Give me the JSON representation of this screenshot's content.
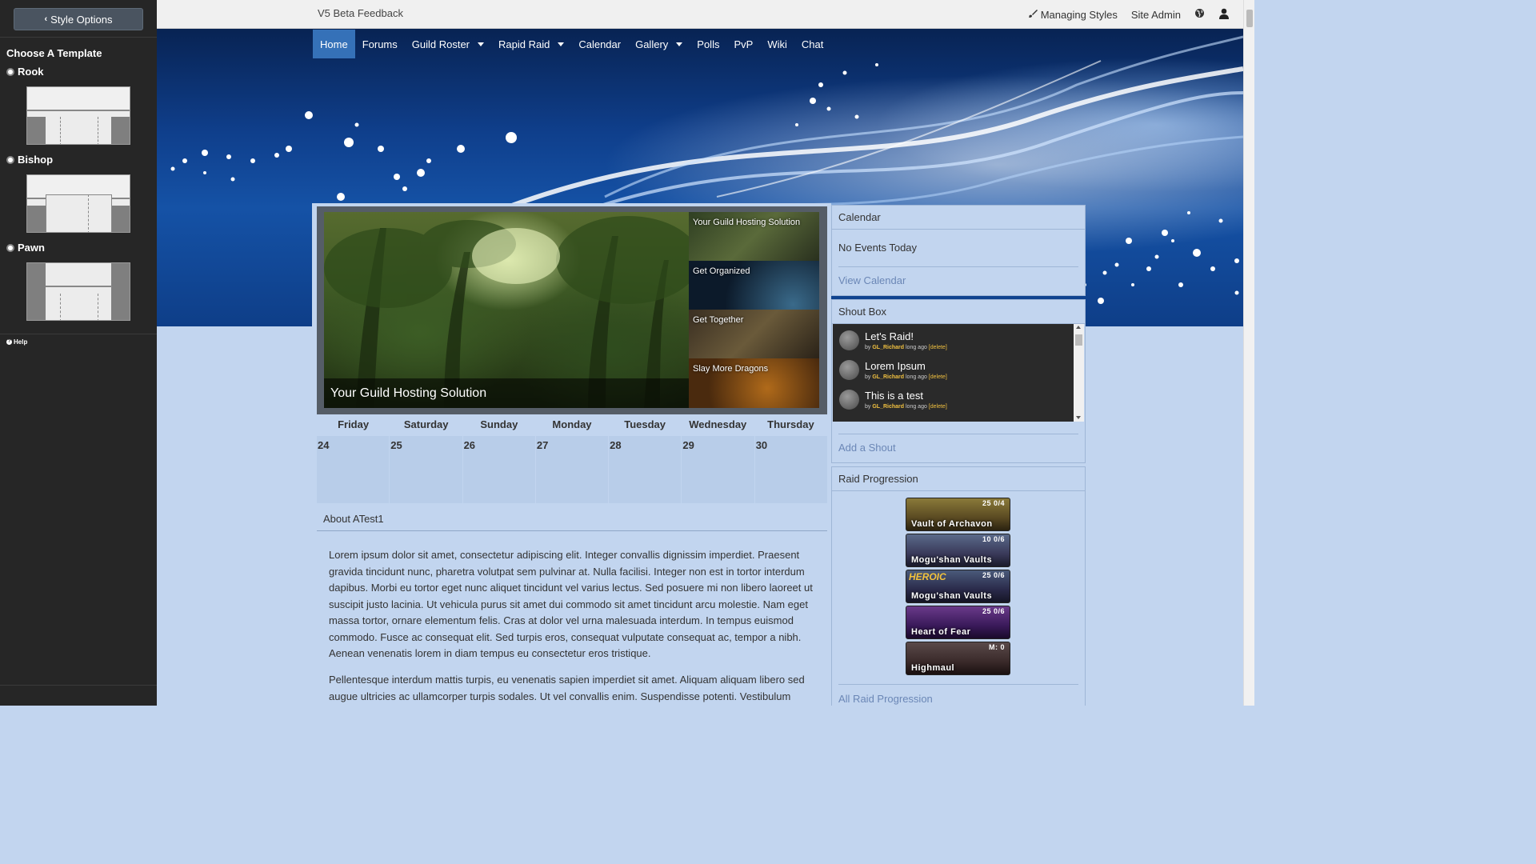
{
  "style_panel": {
    "button_label": "Style Options",
    "choose_label": "Choose A Template",
    "templates": [
      "Rook",
      "Bishop",
      "Pawn"
    ],
    "help_label": "Help"
  },
  "topbar": {
    "site_name": "V5 Beta Feedback",
    "managing_styles": "Managing Styles",
    "site_admin": "Site Admin"
  },
  "nav": {
    "items": [
      "Home",
      "Forums",
      "Guild Roster",
      "Rapid Raid",
      "Calendar",
      "Gallery",
      "Polls",
      "PvP",
      "Wiki",
      "Chat"
    ],
    "active": "Home"
  },
  "slider": {
    "caption": "Your Guild Hosting Solution",
    "thumbs": [
      "Your Guild Hosting Solution",
      "Get Organized",
      "Get Together",
      "Slay More Dragons"
    ]
  },
  "week": {
    "days": [
      "Friday",
      "Saturday",
      "Sunday",
      "Monday",
      "Tuesday",
      "Wednesday",
      "Thursday"
    ],
    "dates": [
      "24",
      "25",
      "26",
      "27",
      "28",
      "29",
      "30"
    ]
  },
  "about": {
    "title": "About ATest1",
    "para1": "Lorem ipsum dolor sit amet, consectetur adipiscing elit. Integer convallis dignissim imperdiet. Praesent gravida tincidunt nunc, pharetra volutpat sem pulvinar at. Nulla facilisi. Integer non est in tortor interdum dapibus. Morbi eu tortor eget nunc aliquet tincidunt vel varius lectus. Sed posuere mi non libero laoreet ut suscipit justo lacinia. Ut vehicula purus sit amet dui commodo sit amet tincidunt arcu molestie. Nam eget massa tortor, ornare elementum felis. Cras at dolor vel urna malesuada interdum. In tempus euismod commodo. Fusce ac consequat elit. Sed turpis eros, consequat vulputate consequat ac, tempor a nibh. Aenean venenatis lorem in diam tempus eu consectetur eros tristique.",
    "para2": "Pellentesque interdum mattis turpis, eu venenatis sapien imperdiet sit amet. Aliquam aliquam libero sed augue ultricies ac ullamcorper turpis sodales. Ut vel convallis enim. Suspendisse potenti. Vestibulum"
  },
  "calendar_panel": {
    "title": "Calendar",
    "empty": "No Events Today",
    "link": "View Calendar"
  },
  "shoutbox": {
    "title": "Shout Box",
    "shouts": [
      {
        "text": "Let's Raid!",
        "by": "by",
        "user": "GL_Richard",
        "when": "long ago",
        "delete": "[delete]"
      },
      {
        "text": "Lorem Ipsum",
        "by": "by",
        "user": "GL_Richard",
        "when": "long ago",
        "delete": "[delete]"
      },
      {
        "text": "This is a test",
        "by": "by",
        "user": "GL_Richard",
        "when": "long ago",
        "delete": "[delete]"
      }
    ],
    "link": "Add a Shout"
  },
  "raids": {
    "title": "Raid Progression",
    "items": [
      {
        "name": "Vault of Archavon",
        "count": "25 0/4",
        "heroic": ""
      },
      {
        "name": "Mogu'shan Vaults",
        "count": "10 0/6",
        "heroic": ""
      },
      {
        "name": "Mogu'shan Vaults",
        "count": "25 0/6",
        "heroic": "HEROIC"
      },
      {
        "name": "Heart of Fear",
        "count": "25 0/6",
        "heroic": ""
      },
      {
        "name": "Highmaul",
        "count": "M: 0",
        "heroic": ""
      }
    ],
    "link": "All Raid Progression"
  },
  "colors": {
    "accent": "#3571b8",
    "page_bg": "#c2d5ef",
    "link": "#6b87b6"
  }
}
